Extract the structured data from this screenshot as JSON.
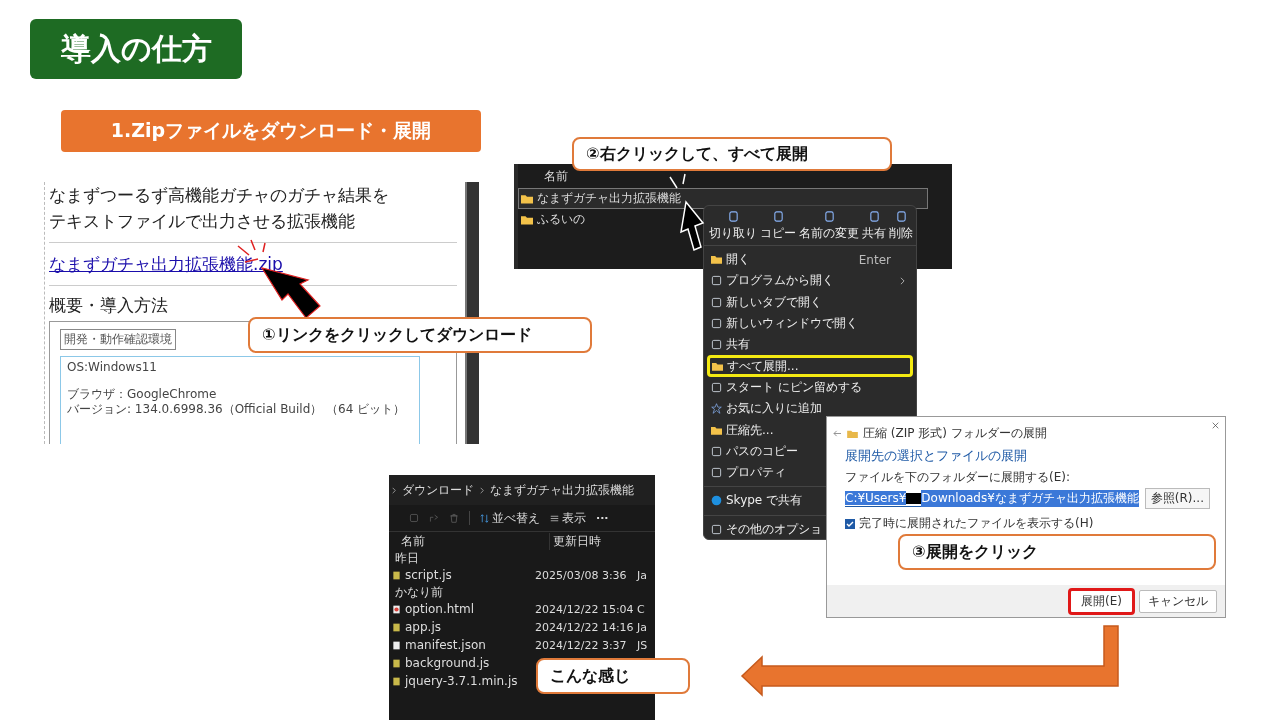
{
  "title": "導入の仕方",
  "step_label": "1.Zipファイルをダウンロード・展開",
  "web_page": {
    "heading_lines": [
      "なまずつーるず高機能ガチャのガチャ結果を",
      "テキストファイルで出力させる拡張機能"
    ],
    "link": "なまずガチャ出力拡張機能.zip",
    "section_title": "概要・導入方法",
    "env_label": "開発・動作確認環境",
    "env_paragraphs": [
      [
        "OS:Windows11"
      ],
      [
        "ブラウザ：GoogleChrome",
        "バージョン: 134.0.6998.36（Official Build） （64 ビット）"
      ]
    ]
  },
  "explorer_list": {
    "column": "名前",
    "items": [
      {
        "name": "なまずガチャ出力拡張機能",
        "selected": true
      },
      {
        "name": "ふるいの",
        "selected": false
      }
    ]
  },
  "context_menu": {
    "actions": [
      "切り取り",
      "コピー",
      "名前の変更",
      "共有",
      "削除"
    ],
    "items": [
      {
        "kind": "item",
        "label": "開く",
        "shortcut": "Enter",
        "submenu": false,
        "highlighted": false
      },
      {
        "kind": "item",
        "label": "プログラムから開く",
        "submenu": true,
        "highlighted": false
      },
      {
        "kind": "item",
        "label": "新しいタブで開く",
        "submenu": false,
        "highlighted": false
      },
      {
        "kind": "item",
        "label": "新しいウィンドウで開く",
        "submenu": false,
        "highlighted": false
      },
      {
        "kind": "item",
        "label": "共有",
        "submenu": false,
        "highlighted": false
      },
      {
        "kind": "item",
        "label": "すべて展開...",
        "submenu": false,
        "highlighted": true
      },
      {
        "kind": "item",
        "label": "スタート にピン留めする",
        "submenu": false,
        "highlighted": false
      },
      {
        "kind": "item",
        "label": "お気に入りに追加",
        "submenu": false,
        "highlighted": false
      },
      {
        "kind": "item",
        "label": "圧縮先...",
        "highlighted": false
      },
      {
        "kind": "item",
        "label": "パスのコピー",
        "highlighted": false
      },
      {
        "kind": "item",
        "label": "プロパティ",
        "highlighted": false
      },
      {
        "kind": "separator"
      },
      {
        "kind": "item",
        "label": "Skype で共有",
        "highlighted": false
      },
      {
        "kind": "separator"
      },
      {
        "kind": "item",
        "label": "その他のオプショ",
        "highlighted": false
      }
    ]
  },
  "extract_dialog": {
    "title": "圧縮 (ZIP 形式) フォルダーの展開",
    "heading": "展開先の選択とファイルの展開",
    "field_label": "ファイルを下のフォルダーに展開する(E):",
    "path_start": "C:¥Users¥",
    "path_end": "Downloads¥なまずガチャ出力拡張機能",
    "browse": "参照(R)...",
    "show_files": {
      "label": "完了時に展開されたファイルを表示する(H)",
      "checked": true
    },
    "buttons": [
      {
        "label": "展開(E)",
        "highlighted": true
      },
      {
        "label": "キャンセル",
        "highlighted": false
      }
    ]
  },
  "folder_view": {
    "breadcrumb": [
      "ダウンロード",
      "なまずガチャ出力拡張機能"
    ],
    "sort": "並べ替え",
    "view": "表示",
    "more": "···",
    "columns": [
      "名前",
      "更新日時"
    ],
    "groups": [
      {
        "label": "昨日",
        "files": [
          {
            "kind": "js",
            "name": "script.js",
            "date": "2025/03/08 3:36",
            "type": "Ja"
          }
        ]
      },
      {
        "label": "かなり前",
        "files": [
          {
            "kind": "html",
            "name": "option.html",
            "date": "2024/12/22 15:04",
            "type": "C"
          },
          {
            "kind": "js",
            "name": "app.js",
            "date": "2024/12/22 14:16",
            "type": "Ja"
          },
          {
            "kind": "json",
            "name": "manifest.json",
            "date": "2024/12/22 3:37",
            "type": "JS"
          },
          {
            "kind": "js",
            "name": "background.js"
          },
          {
            "kind": "js",
            "name": "jquery-3.7.1.min.js"
          }
        ]
      }
    ]
  },
  "callouts": [
    {
      "kind": "download",
      "text": "①リンクをクリックしてダウンロード"
    },
    {
      "kind": "extract",
      "text": "②右クリックして、すべて展開"
    },
    {
      "kind": "click",
      "text": "③展開をクリック"
    },
    {
      "kind": "result",
      "text": "こんな感じ"
    }
  ]
}
